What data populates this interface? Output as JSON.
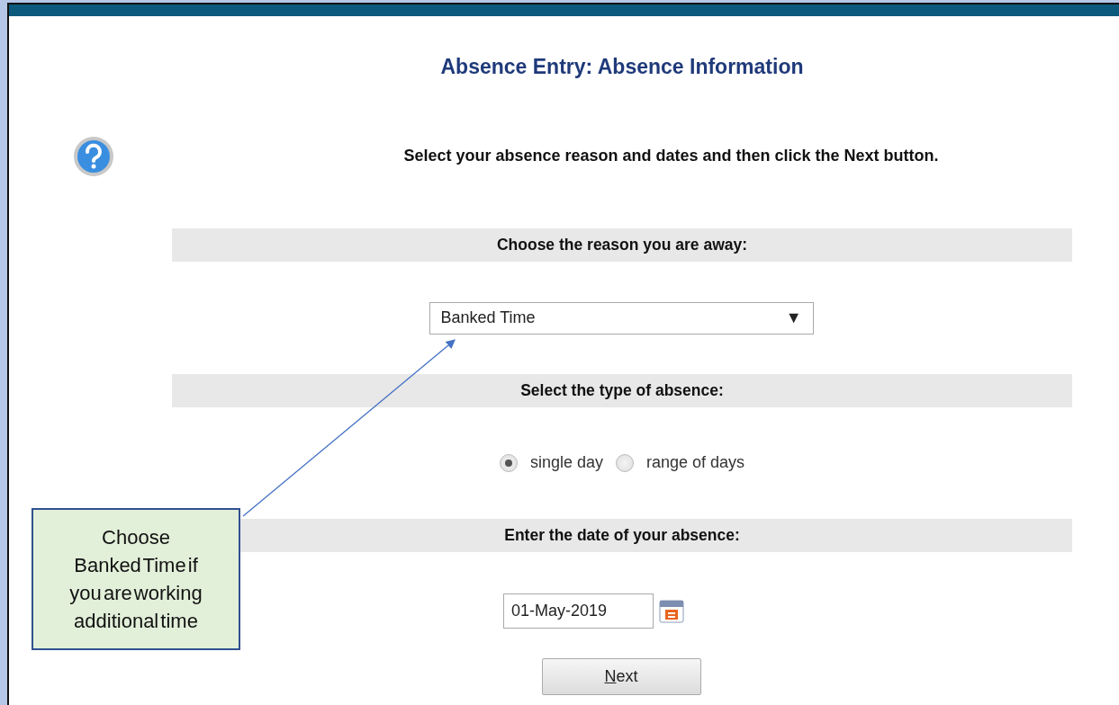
{
  "title": "Absence Entry: Absence Information",
  "instruction": "Select your absence reason and dates and then click the Next button.",
  "reason_section": {
    "heading": "Choose the reason you are away:",
    "value": "Banked Time",
    "arrow": "▼"
  },
  "type_section": {
    "heading": "Select the type of absence:",
    "options": [
      {
        "label": "single day",
        "selected": true
      },
      {
        "label": "range of days",
        "selected": false
      }
    ]
  },
  "date_section": {
    "heading": "Enter the date of your absence:",
    "value": "01-May-2019"
  },
  "next_button": {
    "label_parts": [
      {
        "text": "N",
        "underlined": true
      },
      {
        "text": "ext",
        "underlined": false
      }
    ]
  },
  "callout": {
    "text": "Choose Banked Time if you are working additional time"
  }
}
